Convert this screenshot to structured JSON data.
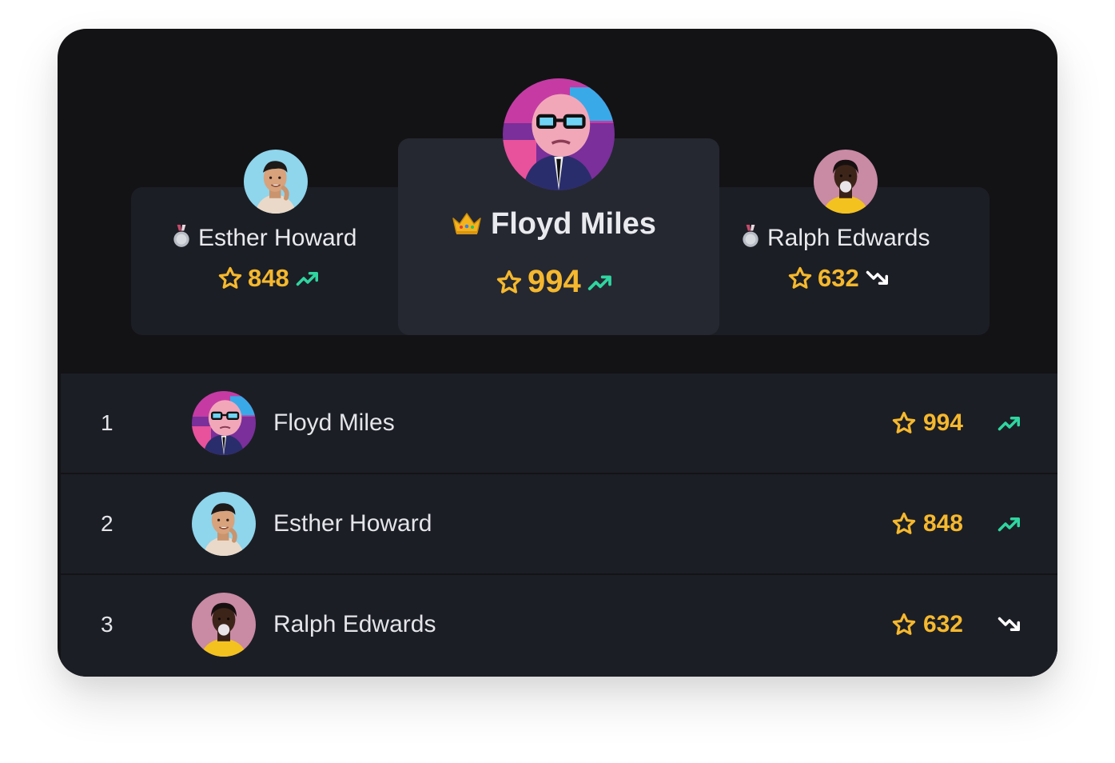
{
  "podium": {
    "first": {
      "name": "Floyd Miles",
      "score": "994",
      "trend": "up",
      "badge": "crown-icon"
    },
    "second": {
      "name": "Esther Howard",
      "score": "848",
      "trend": "up",
      "badge": "medal-icon"
    },
    "third": {
      "name": "Ralph Edwards",
      "score": "632",
      "trend": "down",
      "badge": "medal-icon"
    }
  },
  "rows": [
    {
      "rank": "1",
      "name": "Floyd Miles",
      "score": "994",
      "trend": "up"
    },
    {
      "rank": "2",
      "name": "Esther Howard",
      "score": "848",
      "trend": "up"
    },
    {
      "rank": "3",
      "name": "Ralph Edwards",
      "score": "632",
      "trend": "down"
    }
  ],
  "colors": {
    "background": "#131316",
    "panel": "#1c1e25",
    "panel_highlight": "#252831",
    "score": "#f5b82e",
    "trend_up": "#2fd6a0",
    "trend_down": "#ffffff",
    "text": "#e9eaee"
  }
}
